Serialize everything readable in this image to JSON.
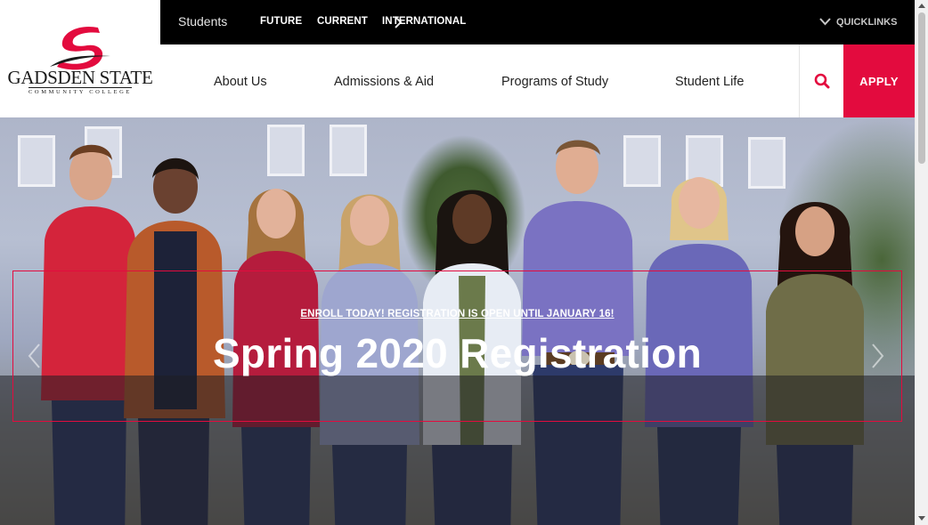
{
  "logo": {
    "name": "GADSDEN STATE",
    "subtitle": "COMMUNITY COLLEGE"
  },
  "topbar": {
    "audience_label": "Students",
    "audience_links": [
      "FUTURE",
      "CURRENT",
      "INTERNATIONAL"
    ],
    "quicklinks_label": "QUICKLINKS"
  },
  "nav": {
    "items": [
      "About Us",
      "Admissions & Aid",
      "Programs of Study",
      "Student Life"
    ],
    "apply_label": "APPLY"
  },
  "hero": {
    "kicker": "ENROLL TODAY! REGISTRATION IS OPEN UNTIL JANUARY 16!",
    "title": "Spring 2020 Registration"
  },
  "colors": {
    "brand": "#e30b3e",
    "topbar": "#000000"
  },
  "icons": [
    "logo-swoosh",
    "chevron-right-icon",
    "chevron-down-icon",
    "search-icon",
    "prev-arrow-icon",
    "next-arrow-icon"
  ]
}
